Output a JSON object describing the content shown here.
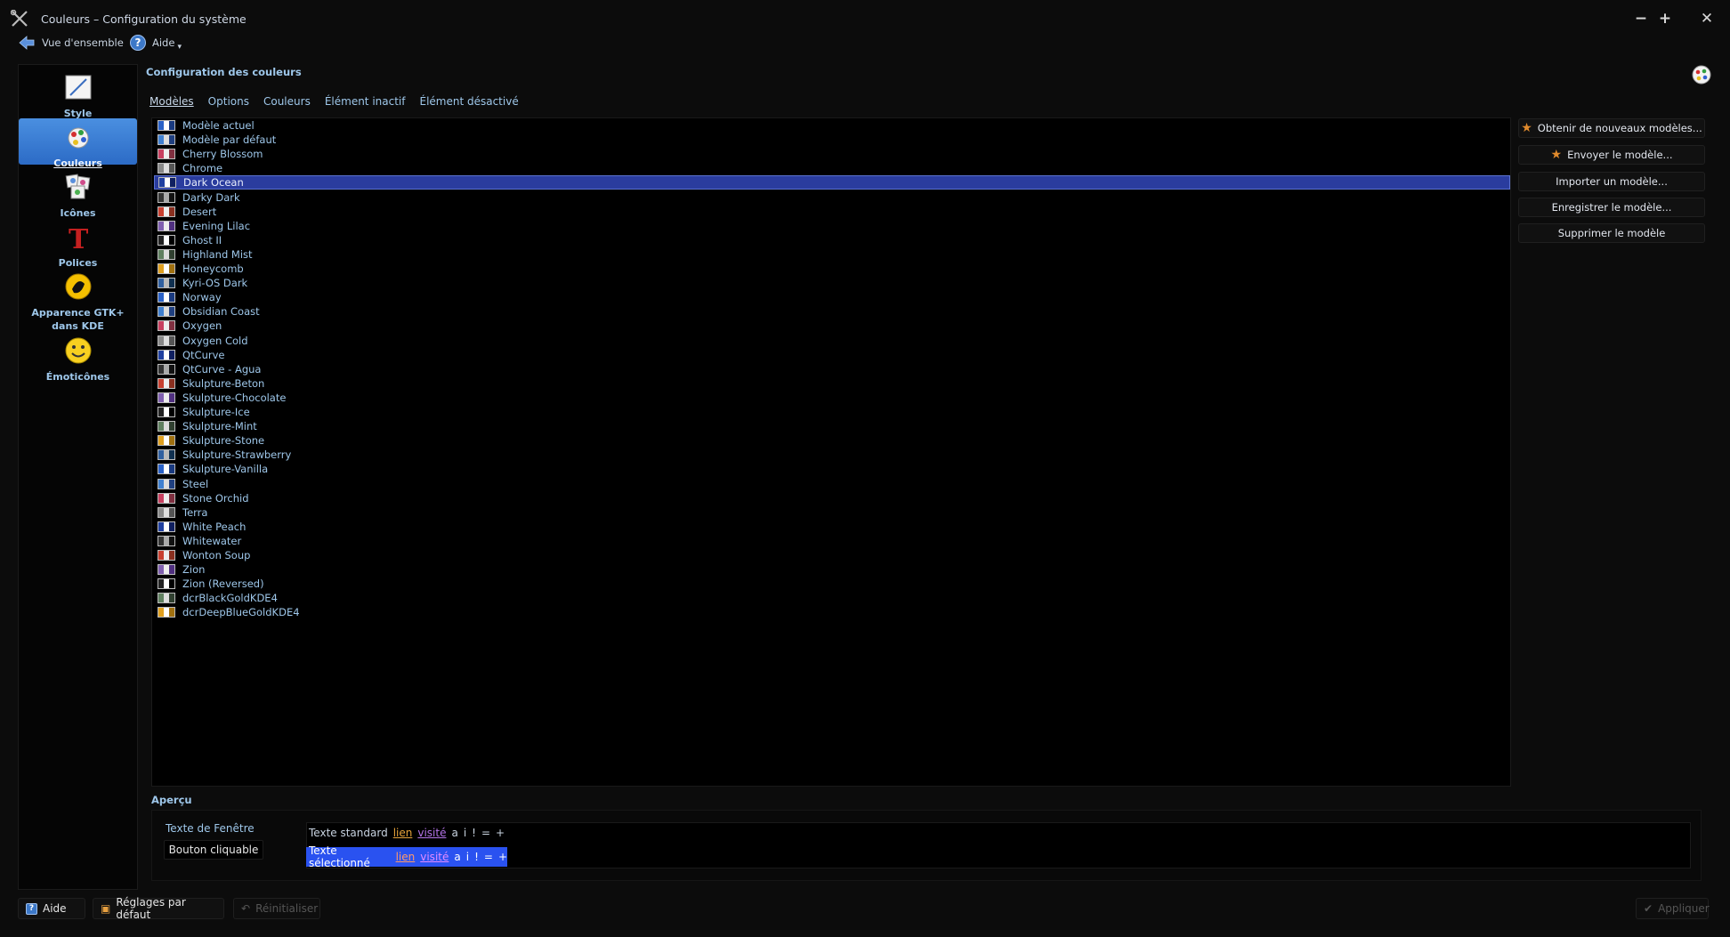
{
  "window": {
    "title": "Couleurs – Configuration du système",
    "minimize": "−",
    "maximize": "+",
    "close": "✕"
  },
  "toolbar": {
    "overview_label": "Vue d'ensemble",
    "help_label": "Aide",
    "help_caret": "▾"
  },
  "sidebar": {
    "items": [
      {
        "label": "Style",
        "icon": "style-icon"
      },
      {
        "label": "Couleurs",
        "icon": "colors-icon"
      },
      {
        "label": "Icônes",
        "icon": "icons-icon"
      },
      {
        "label": "Polices",
        "icon": "fonts-icon"
      },
      {
        "label": "Apparence GTK+ dans KDE",
        "icon": "gtk-icon"
      },
      {
        "label": "Émoticônes",
        "icon": "emoticons-icon"
      }
    ]
  },
  "header": {
    "title": "Configuration des couleurs"
  },
  "tabs": [
    "Modèles",
    "Options",
    "Couleurs",
    "Élément inactif",
    "Élément désactivé"
  ],
  "schemes": [
    "Modèle actuel",
    "Modèle par défaut",
    "Cherry Blossom",
    "Chrome",
    "Dark Ocean",
    "Darky Dark",
    "Desert",
    "Evening Lilac",
    "Ghost II",
    "Highland Mist",
    "Honeycomb",
    "Kyri-OS Dark",
    "Norway",
    "Obsidian Coast",
    "Oxygen",
    "Oxygen Cold",
    "QtCurve",
    "QtCurve - Agua",
    "Skulpture-Beton",
    "Skulpture-Chocolate",
    "Skulpture-Ice",
    "Skulpture-Mint",
    "Skulpture-Stone",
    "Skulpture-Strawberry",
    "Skulpture-Vanilla",
    "Steel",
    "Stone Orchid",
    "Terra",
    "White Peach",
    "Whitewater",
    "Wonton Soup",
    "Zion",
    "Zion (Reversed)",
    "dcrBlackGoldKDE4",
    "dcrDeepBlueGoldKDE4"
  ],
  "selected_scheme": "Dark Ocean",
  "scheme_buttons": {
    "get_new": "Obtenir de nouveaux modèles...",
    "upload": "Envoyer le modèle...",
    "import": "Importer un modèle...",
    "save": "Enregistrer le modèle...",
    "remove": "Supprimer le modèle"
  },
  "preview": {
    "title": "Aperçu",
    "window_text": "Texte de Fenêtre",
    "button_text": "Bouton cliquable",
    "standard_text": "Texte standard",
    "selected_text": "Texte sélectionné",
    "link": "lien",
    "visited": "visité",
    "symbols": [
      "a",
      "i",
      "!",
      "=",
      "+"
    ]
  },
  "bottom": {
    "help": "Aide",
    "defaults": "Réglages par défaut",
    "reset": "Réinitialiser",
    "apply": "Appliquer"
  },
  "colors": {
    "selection": "#2a3c9e",
    "accent_text": "#9ec7ea",
    "sidebar_active": "#3a7ed8",
    "selected_preview": "#2a52f0",
    "link": "#e7a33a",
    "visited": "#b474e8"
  }
}
